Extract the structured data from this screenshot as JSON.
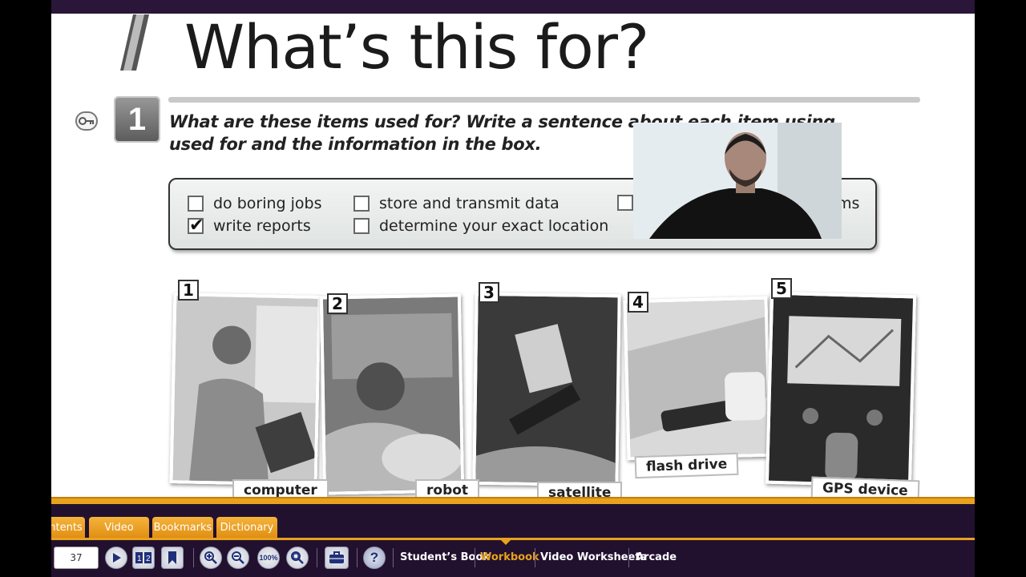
{
  "page": {
    "title": "What’s this for?",
    "exercise_number": "1",
    "instruction_line1": "What are these items used for? Write a sentence about each item using",
    "instruction_line2": "used for and the information in the box."
  },
  "word_box": {
    "options": [
      {
        "label": "do boring jobs",
        "checked": false
      },
      {
        "label": "write reports",
        "checked": true
      },
      {
        "label": "store and transmit data",
        "checked": false
      },
      {
        "label": "determine your exact location",
        "checked": false
      },
      {
        "label": "ms",
        "checked": false
      }
    ]
  },
  "photos": [
    {
      "number": "1",
      "caption": "computer"
    },
    {
      "number": "2",
      "caption": "robot"
    },
    {
      "number": "3",
      "caption": "satellite"
    },
    {
      "number": "4",
      "caption": "flash drive"
    },
    {
      "number": "5",
      "caption": "GPS device"
    }
  ],
  "toolbar": {
    "tabs": [
      "ntents",
      "Video",
      "Bookmarks",
      "Dictionary"
    ],
    "page_number": "37",
    "zoom_label": "100%",
    "nav_links": [
      "Student’s Book",
      "Workbook",
      "Video Worksheets",
      "Arcade"
    ],
    "active_nav": "Workbook",
    "accent_color": "#e8a21c",
    "bar_color": "#22102f"
  },
  "icons": [
    "key-icon",
    "play-icon",
    "two-page-icon",
    "bookmark-icon",
    "zoom-in-icon",
    "zoom-out-icon",
    "zoom-100-icon",
    "zoom-fit-icon",
    "toolbox-icon",
    "help-icon"
  ]
}
